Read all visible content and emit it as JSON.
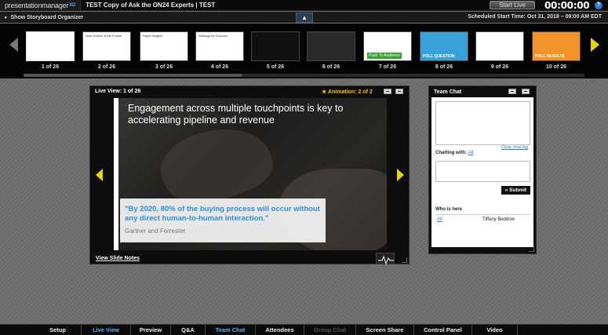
{
  "app": {
    "logo_text": "presentationmanager",
    "logo_suffix": "XD",
    "title": "TEST Copy of Ask the ON24 Experts | TEST",
    "start_live_label": "Start Live",
    "timer": "00:00:00",
    "help_label": "?"
  },
  "storyboard": {
    "toggle_label": "Show Storyboard Organizer",
    "collapse_glyph": "▲",
    "scheduled": "Scheduled Start Time: Oct 31, 2018 – 09:00 AM EDT"
  },
  "thumbnails": [
    {
      "label": "1 of 26",
      "caption": "",
      "bg": "#ffffff",
      "selected": true
    },
    {
      "label": "2 of 26",
      "caption": "New Outline of the Funnel",
      "bg": "#ffffff",
      "selected": false
    },
    {
      "label": "3 of 26",
      "caption": "Rapid Insights",
      "bg": "#ffffff",
      "selected": false
    },
    {
      "label": "4 of 26",
      "caption": "Strategy for Success",
      "bg": "#ffffff",
      "selected": false
    },
    {
      "label": "5 of 26",
      "caption": "",
      "bg": "#111111",
      "selected": false
    },
    {
      "label": "6 of 26",
      "caption": "",
      "bg": "#2a2a2a",
      "selected": false
    },
    {
      "label": "7 of 26",
      "caption": "Push To Audience",
      "bg": "#ffffff",
      "selected": false
    },
    {
      "label": "8 of 26",
      "caption": "POLL QUESTION",
      "bg": "#3aa0d8",
      "selected": false
    },
    {
      "label": "9 of 26",
      "caption": "",
      "bg": "#ffffff",
      "selected": false
    },
    {
      "label": "10 of 26",
      "caption": "POLL RESULTS",
      "bg": "#f2932a",
      "selected": false
    }
  ],
  "live_view": {
    "title": "Live View: 1 of 26",
    "animation": "Animation: 2 of 2",
    "headline": "Engagement across multiple touchpoints is key to accelerating pipeline and revenue",
    "quote": "\"By 2020, 80% of the buying process will occur without any direct human-to-human interaction.\"",
    "source": "Gartner and Forrester",
    "notes_link": "View Slide Notes"
  },
  "team_chat": {
    "title": "Team Chat",
    "chatting_with_label": "Chatting with:",
    "chatting_with_value": "All",
    "clear_chat": "Clear chat log",
    "submit_label": "» Submit",
    "who_label": "Who is here",
    "who_all": "All",
    "who_name": "Tiffany Beddow"
  },
  "bottom_nav": [
    {
      "label": "Setup",
      "state": "normal"
    },
    {
      "label": "Live View",
      "state": "active"
    },
    {
      "label": "Preview",
      "state": "normal"
    },
    {
      "label": "Q&A",
      "state": "normal"
    },
    {
      "label": "Team Chat",
      "state": "active"
    },
    {
      "label": "Attendees",
      "state": "normal"
    },
    {
      "label": "Group Chat",
      "state": "disabled"
    },
    {
      "label": "Screen Share",
      "state": "normal"
    },
    {
      "label": "Control Panel",
      "state": "normal"
    },
    {
      "label": "Video",
      "state": "normal"
    }
  ]
}
